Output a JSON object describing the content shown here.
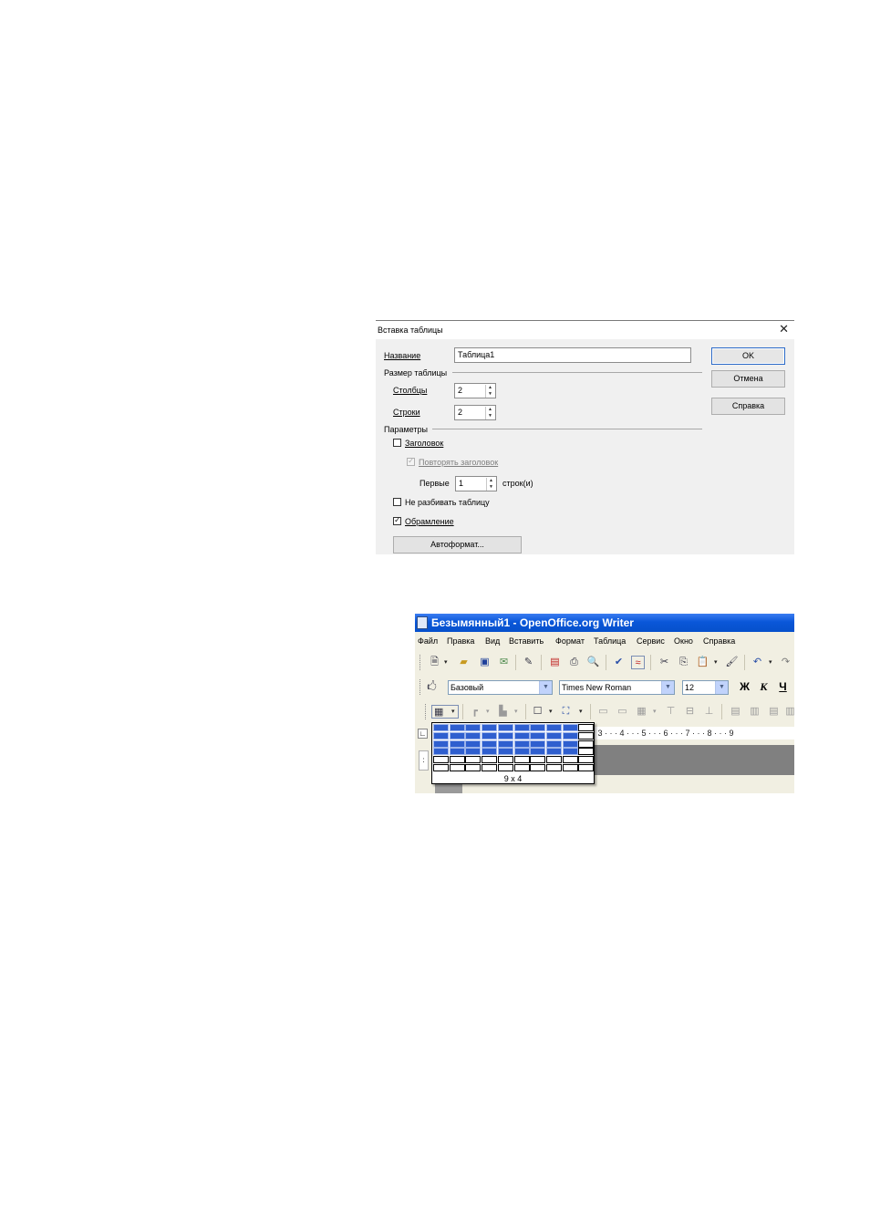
{
  "dialog": {
    "title": "Вставка таблицы",
    "close_glyph": "✕",
    "name_label": "Название",
    "name_value": "Таблица1",
    "size_section": "Размер таблицы",
    "columns_label": "Столбцы",
    "columns_value": "2",
    "rows_label": "Строки",
    "rows_value": "2",
    "params_section": "Параметры",
    "header_label": "Заголовок",
    "header_checked": false,
    "repeat_header_label": "Повторять заголовок",
    "repeat_header_checked": true,
    "repeat_header_enabled": false,
    "first_label": "Первые",
    "first_value": "1",
    "first_suffix": "строк(и)",
    "no_split_label": "Не разбивать таблицу",
    "no_split_checked": false,
    "border_label": "Обрамление",
    "border_checked": true,
    "autoformat_label": "Автоформат...",
    "ok_label": "OK",
    "cancel_label": "Отмена",
    "help_label": "Справка"
  },
  "writer": {
    "title": "Безымянный1 - OpenOffice.org Writer",
    "menu": [
      "Файл",
      "Правка",
      "Вид",
      "Вставить",
      "Формат",
      "Таблица",
      "Сервис",
      "Окно",
      "Справка"
    ],
    "style_value": "Базовый",
    "font_value": "Times New Roman",
    "size_value": "12",
    "bold_label": "Ж",
    "italic_label": "К",
    "underline_label": "Ч",
    "ruler_text": "· 3 · · · 4 · · · 5 · · · 6 · · · 7 · · · 8 · · · 9",
    "grid_popup": {
      "columns_total": 10,
      "rows_total": 6,
      "selected_columns": 9,
      "selected_rows": 4,
      "label": "9 x 4",
      "selected_color": "#2f5fcf"
    },
    "titlebar_color": "#0a57d9"
  }
}
